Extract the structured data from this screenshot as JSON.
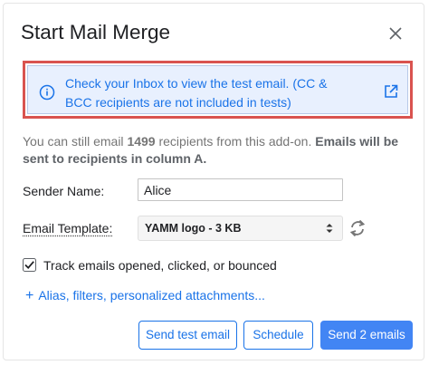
{
  "dialog": {
    "title": "Start Mail Merge",
    "close_icon": "close-icon"
  },
  "alert": {
    "icon": "info-icon",
    "text": "Check your Inbox to view the test email. (CC & BCC recipients are not included in tests)",
    "link_icon": "open-in-new-icon",
    "border_color": "#d9534f",
    "background": "#e8f0fe",
    "text_color": "#1a73e8"
  },
  "quota": {
    "prefix": "You can still email ",
    "count": "1499",
    "middle": " recipients from this add-on. ",
    "emphasis": "Emails will be sent to recipients in column A."
  },
  "form": {
    "sender_label": "Sender Name:",
    "sender_value": "Alice",
    "template_label": "Email Template:",
    "template_value": "YAMM logo - 3 KB",
    "refresh_icon": "refresh-icon",
    "track_checked": true,
    "track_label": "Track emails opened, clicked, or bounced",
    "options_plus": "+",
    "options_link": "Alias, filters, personalized attachments..."
  },
  "buttons": {
    "test": "Send test email",
    "schedule": "Schedule",
    "send": "Send 2 emails",
    "primary_color": "#4285f4"
  }
}
